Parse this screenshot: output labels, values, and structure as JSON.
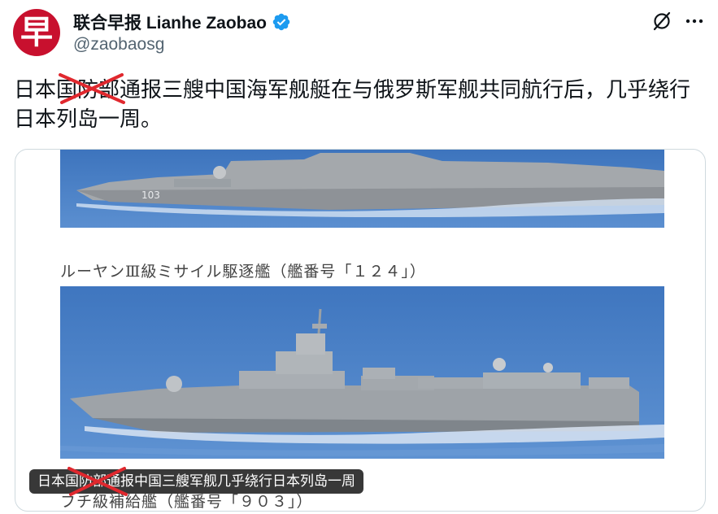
{
  "author": {
    "avatar_glyph": "早",
    "display_name": "联合早报 Lianhe Zaobao",
    "handle": "@zaobaosg",
    "verified": true
  },
  "actions": {
    "grok_icon": "grok-icon",
    "more_icon": "more-icon"
  },
  "tweet": {
    "text": "日本国防部通报三艘中国海军舰艇在与俄罗斯军舰共同航行后，几乎绕行日本列岛一周。"
  },
  "media": {
    "caption_1": "ルーヤンⅢ級ミサイル駆逐艦（艦番号「１２４」）",
    "caption_2": "フチ級補給艦（艦番号「９０３」）",
    "overlay_title": "日本国防部通报中国三艘军舰几乎绕行日本列岛一周",
    "hull_number_top": "103"
  },
  "colors": {
    "brand_red": "#c8102e",
    "verified_blue": "#1d9bf0",
    "strike_red": "#e0282e",
    "sea_blue": "#4a82c7"
  }
}
